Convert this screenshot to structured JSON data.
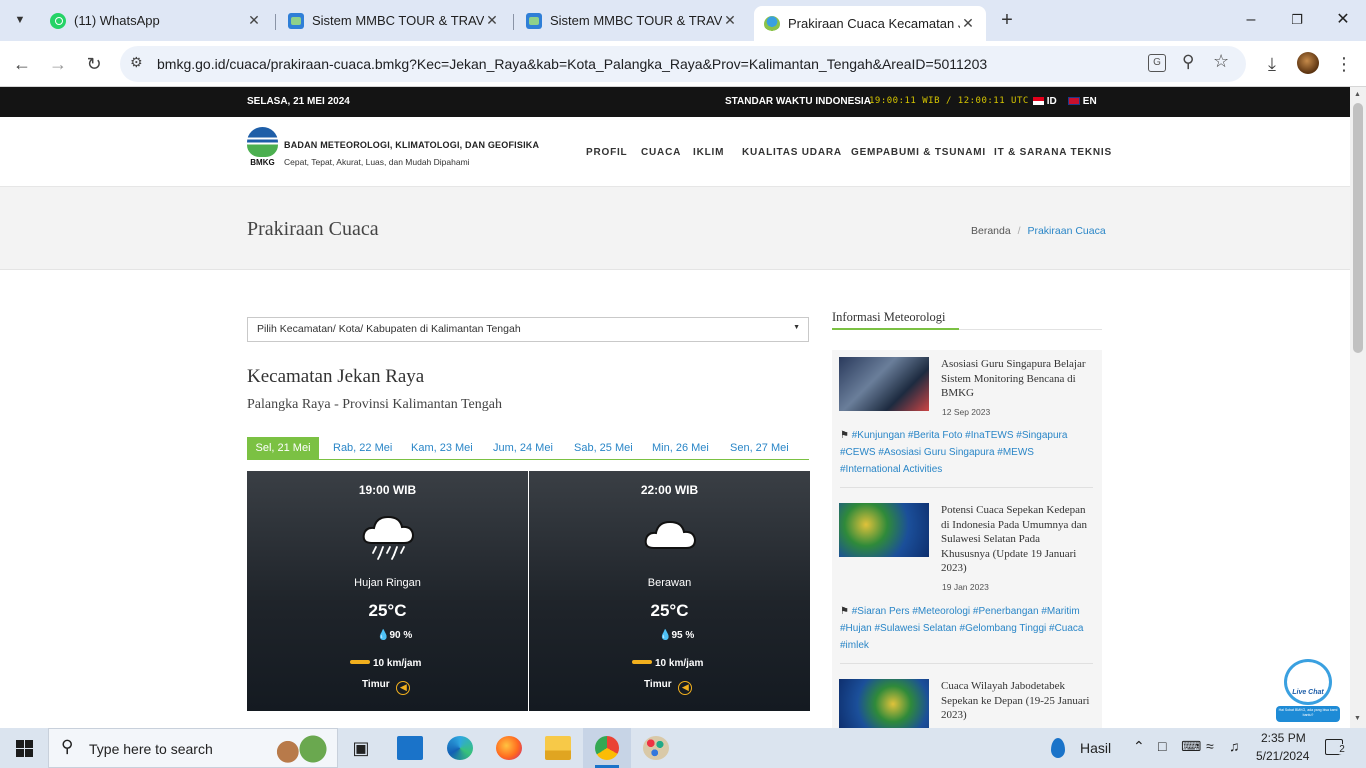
{
  "browser": {
    "tabs": [
      {
        "title": "(11) WhatsApp"
      },
      {
        "title": "Sistem MMBC TOUR & TRAVEL"
      },
      {
        "title": "Sistem MMBC TOUR & TRAVEL"
      },
      {
        "title": "Prakiraan Cuaca Kecamatan Jek"
      }
    ],
    "url": "bmkg.go.id/cuaca/prakiraan-cuaca.bmkg?Kec=Jekan_Raya&kab=Kota_Palangka_Raya&Prov=Kalimantan_Tengah&AreaID=5011203"
  },
  "topstrip": {
    "date": "SELASA, 21 MEI 2024",
    "std_label": "STANDAR WAKTU INDONESIA",
    "clock": "19:00:11 WIB / 12:00:11 UTC",
    "lang_id": "ID",
    "lang_en": "EN"
  },
  "header": {
    "logo_text": "BMKG",
    "org_name": "BADAN METEOROLOGI, KLIMATOLOGI, DAN GEOFISIKA",
    "tagline": "Cepat, Tepat, Akurat, Luas, dan Mudah Dipahami",
    "nav": [
      "PROFIL",
      "CUACA",
      "IKLIM",
      "KUALITAS UDARA",
      "GEMPABUMI & TSUNAMI",
      "IT & SARANA TEKNIS"
    ]
  },
  "titlebar": {
    "title": "Prakiraan Cuaca",
    "breadcrumb_home": "Beranda",
    "breadcrumb_sep": "/",
    "breadcrumb_current": "Prakiraan Cuaca"
  },
  "forecast": {
    "select_placeholder": "Pilih Kecamatan/ Kota/ Kabupaten di Kalimantan Tengah",
    "district": "Kecamatan Jekan Raya",
    "region": "Palangka Raya - Provinsi Kalimantan Tengah",
    "days": [
      "Sel, 21 Mei",
      "Rab, 22 Mei",
      "Kam, 23 Mei",
      "Jum, 24 Mei",
      "Sab, 25 Mei",
      "Min, 26 Mei",
      "Sen, 27 Mei"
    ],
    "cards": [
      {
        "time": "19:00 WIB",
        "condition": "Hujan Ringan",
        "temp": "25°C",
        "humidity": "90 %",
        "wind": "10 km/jam",
        "direction": "Timur",
        "icon": "rain-cloud-icon"
      },
      {
        "time": "22:00 WIB",
        "condition": "Berawan",
        "temp": "25°C",
        "humidity": "95 %",
        "wind": "10 km/jam",
        "direction": "Timur",
        "icon": "cloud-icon"
      }
    ]
  },
  "sidebar": {
    "heading": "Informasi Meteorologi",
    "news": [
      {
        "title": "Asosiasi Guru Singapura Belajar Sistem Monitoring Bencana di BMKG",
        "date": "12 Sep 2023",
        "tags": "#Kunjungan #Berita Foto #InaTEWS #Singapura #CEWS #Asosiasi Guru Singapura #MEWS #International Activities"
      },
      {
        "title": "Potensi Cuaca Sepekan Kedepan di Indonesia Pada Umumnya dan Sulawesi Selatan Pada Khususnya (Update 19 Januari 2023)",
        "date": "19 Jan 2023",
        "tags": "#Siaran Pers #Meteorologi #Penerbangan #Maritim #Hujan #Sulawesi Selatan #Gelombang Tinggi #Cuaca #imlek"
      },
      {
        "title": "Cuaca Wilayah Jabodetabek Sepekan ke Depan (19-25 Januari 2023)",
        "date": "",
        "tags": ""
      }
    ]
  },
  "livechat": {
    "label": "Live Chat",
    "sub": "Hai Sobat BMKG, ada yang bisa kami bantu?"
  },
  "taskbar": {
    "search_placeholder": "Type here to search",
    "weather": "Hasil",
    "time": "2:35 PM",
    "date": "5/21/2024",
    "notif_count": "2"
  }
}
